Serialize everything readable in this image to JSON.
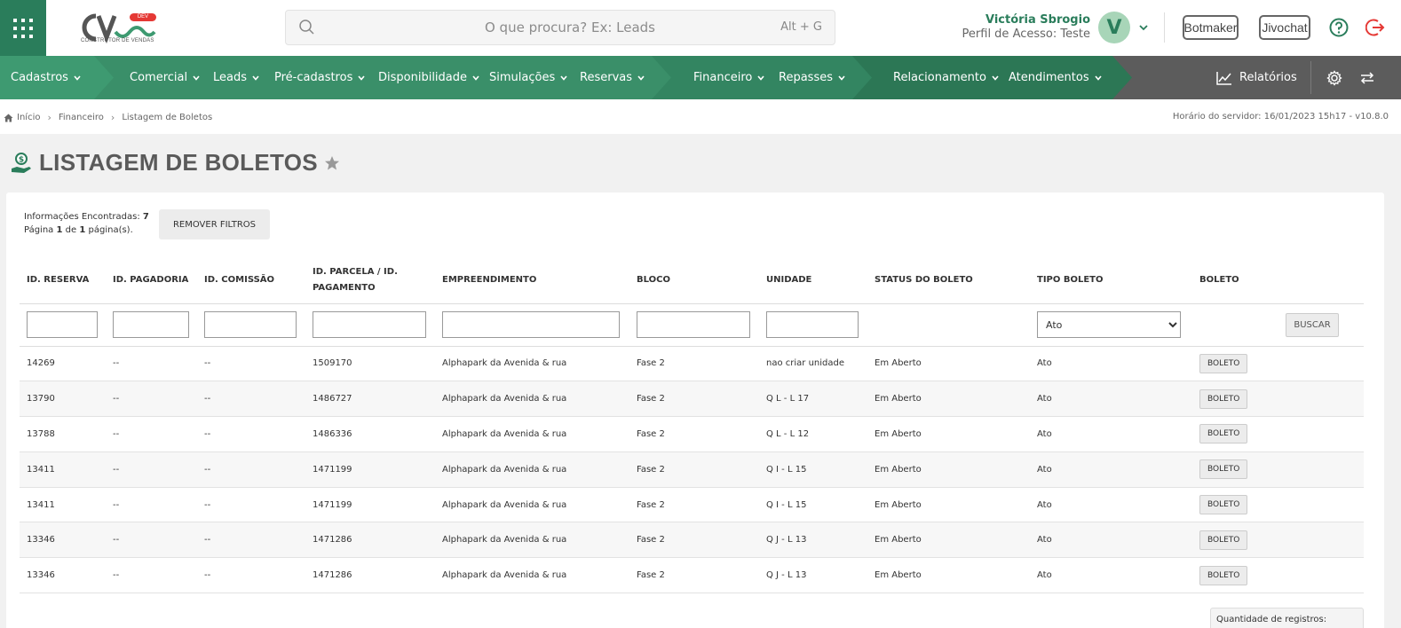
{
  "header": {
    "logo_text": "CV",
    "logo_sub": "CONSTRUTOR DE VENDAS",
    "logo_badge": "DEV",
    "search_placeholder": "O que procura? Ex: Leads",
    "search_shortcut": "Alt + G",
    "user_name": "Victória Sbrogio",
    "user_profile": "Perfil de Acesso: Teste",
    "avatar_letter": "V",
    "botmaker_label": "Botmaker",
    "jivochat_label": "Jivochat",
    "accent_color": "#2a7d5b"
  },
  "nav": {
    "items": [
      {
        "label": "Cadastros"
      },
      {
        "label": "Comercial"
      },
      {
        "label": "Leads"
      },
      {
        "label": "Pré-cadastros"
      },
      {
        "label": "Disponibilidade"
      },
      {
        "label": "Simulações"
      },
      {
        "label": "Reservas"
      },
      {
        "label": "Financeiro"
      },
      {
        "label": "Repasses"
      },
      {
        "label": "Relacionamento"
      },
      {
        "label": "Atendimentos"
      }
    ],
    "reports_label": "Relatórios"
  },
  "breadcrumb": {
    "home": "Início",
    "section": "Financeiro",
    "current": "Listagem de Boletos",
    "server_time": "Horário do servidor: 16/01/2023 15h17 - v10.8.0"
  },
  "page": {
    "title": "LISTAGEM DE BOLETOS"
  },
  "results": {
    "found_label": "Informações Encontradas:",
    "found_count": "7",
    "page_word": "Página",
    "page_current": "1",
    "page_of": "de",
    "page_total": "1",
    "page_suffix": "página(s).",
    "remove_filters_label": "REMOVER FILTROS"
  },
  "table": {
    "headers": [
      "ID. RESERVA",
      "ID. PAGADORIA",
      "ID. COMISSÃO",
      "ID. PARCELA / ID. PAGAMENTO",
      "EMPREENDIMENTO",
      "BLOCO",
      "UNIDADE",
      "STATUS DO BOLETO",
      "TIPO BOLETO",
      "BOLETO"
    ],
    "tipo_filter_value": "Ato",
    "buscar_label": "BUSCAR",
    "boleto_label": "BOLETO",
    "rows": [
      {
        "reserva": "14269",
        "pagadoria": "--",
        "comissao": "--",
        "parcela": "1509170",
        "empreendimento": "Alphapark da Avenida & rua",
        "bloco": "Fase 2",
        "unidade": "nao criar unidade",
        "status": "Em Aberto",
        "tipo": "Ato"
      },
      {
        "reserva": "13790",
        "pagadoria": "--",
        "comissao": "--",
        "parcela": "1486727",
        "empreendimento": "Alphapark da Avenida & rua",
        "bloco": "Fase 2",
        "unidade": "Q L - L 17",
        "status": "Em Aberto",
        "tipo": "Ato"
      },
      {
        "reserva": "13788",
        "pagadoria": "--",
        "comissao": "--",
        "parcela": "1486336",
        "empreendimento": "Alphapark da Avenida & rua",
        "bloco": "Fase 2",
        "unidade": "Q L - L 12",
        "status": "Em Aberto",
        "tipo": "Ato"
      },
      {
        "reserva": "13411",
        "pagadoria": "--",
        "comissao": "--",
        "parcela": "1471199",
        "empreendimento": "Alphapark da Avenida & rua",
        "bloco": "Fase 2",
        "unidade": "Q I - L 15",
        "status": "Em Aberto",
        "tipo": "Ato"
      },
      {
        "reserva": "13411",
        "pagadoria": "--",
        "comissao": "--",
        "parcela": "1471199",
        "empreendimento": "Alphapark da Avenida & rua",
        "bloco": "Fase 2",
        "unidade": "Q I - L 15",
        "status": "Em Aberto",
        "tipo": "Ato"
      },
      {
        "reserva": "13346",
        "pagadoria": "--",
        "comissao": "--",
        "parcela": "1471286",
        "empreendimento": "Alphapark da Avenida & rua",
        "bloco": "Fase 2",
        "unidade": "Q J - L 13",
        "status": "Em Aberto",
        "tipo": "Ato"
      },
      {
        "reserva": "13346",
        "pagadoria": "--",
        "comissao": "--",
        "parcela": "1471286",
        "empreendimento": "Alphapark da Avenida & rua",
        "bloco": "Fase 2",
        "unidade": "Q J - L 13",
        "status": "Em Aberto",
        "tipo": "Ato"
      }
    ]
  },
  "footer": {
    "qty_label": "Quantidade de registros:"
  }
}
